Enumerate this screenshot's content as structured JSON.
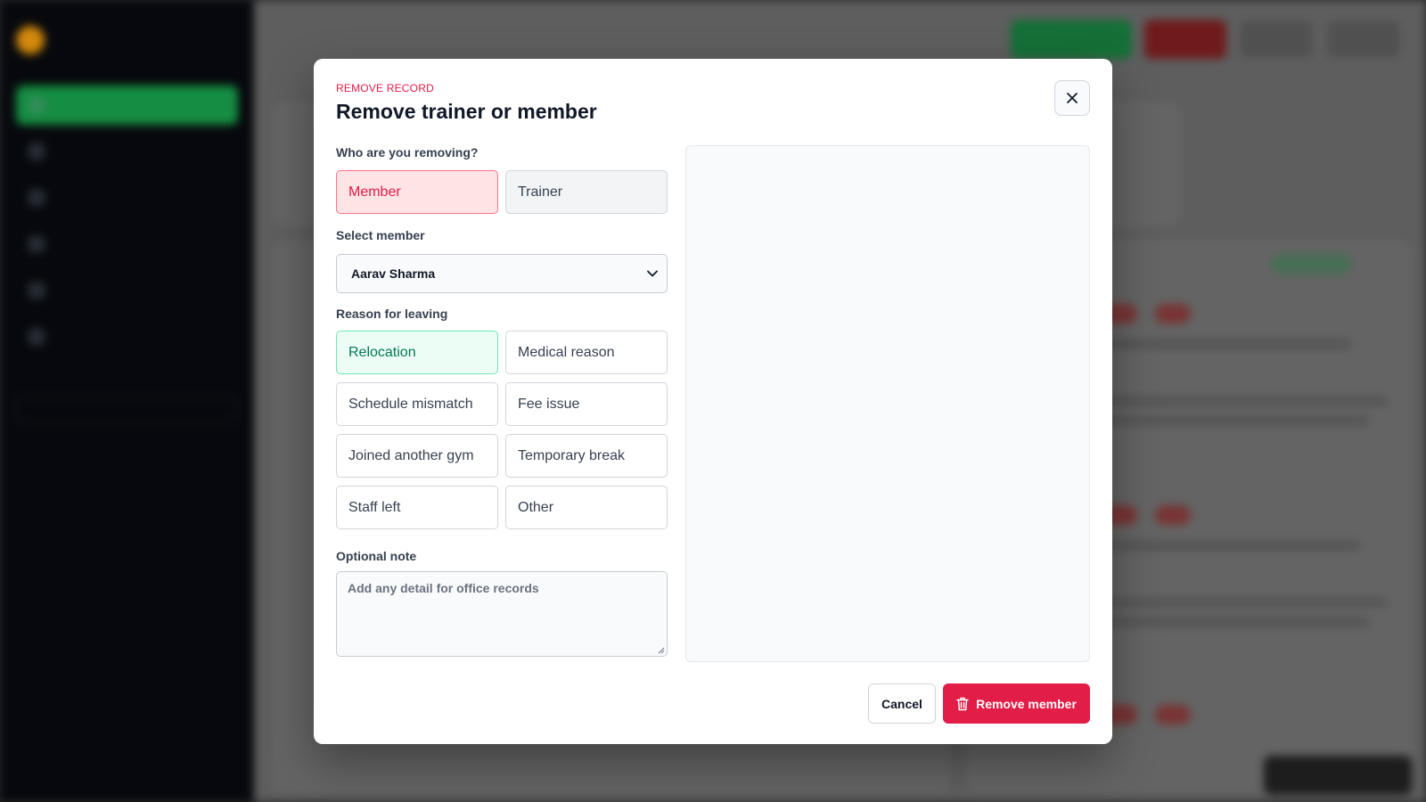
{
  "background": {
    "brand_name": "",
    "brand_tag": "",
    "nav_items": [
      "",
      "",
      "",
      "",
      "",
      ""
    ],
    "sidebar_note": "",
    "page_title": "",
    "breadcrumb": ""
  },
  "modal": {
    "eyebrow": "REMOVE RECORD",
    "title": "Remove trainer or member",
    "who_label": "Who are you removing?",
    "who_options": [
      "Member",
      "Trainer"
    ],
    "who_selected": "Member",
    "select_label": "Select member",
    "select_value": "Aarav Sharma",
    "reason_label": "Reason for leaving",
    "reasons": [
      "Relocation",
      "Medical reason",
      "Schedule mismatch",
      "Fee issue",
      "Joined another gym",
      "Temporary break",
      "Staff left",
      "Other"
    ],
    "reason_selected": "Relocation",
    "note_label": "Optional note",
    "note_placeholder": "Add any detail for office records",
    "cancel_label": "Cancel",
    "remove_label": "Remove member"
  },
  "colors": {
    "accent_danger": "#e11d48",
    "accent_success": "#047857",
    "sidebar_bg": "#05070c",
    "primary_green": "#16a34a"
  },
  "icons": [
    "close-icon",
    "chevron-down-icon",
    "trash-icon",
    "textarea-resize-icon"
  ]
}
